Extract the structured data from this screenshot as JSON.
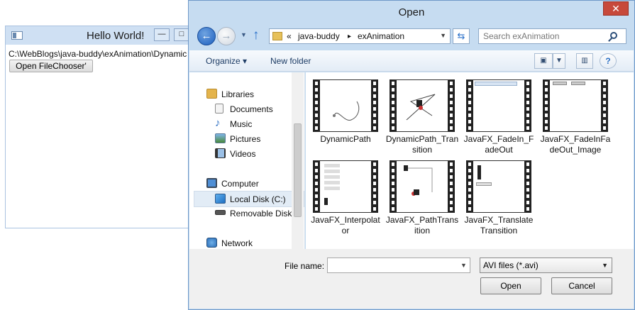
{
  "background_window": {
    "title": "Hello World!",
    "path_text": "C:\\WebBlogs\\java-buddy\\exAnimation\\Dynamic",
    "button_label": "Open FileChooser'",
    "minimize_symbol": "—",
    "maximize_symbol": "□"
  },
  "dialog": {
    "title": "Open",
    "close_symbol": "✕",
    "address": {
      "prefix": "«",
      "crumbs": [
        "java-buddy",
        "exAnimation"
      ],
      "separator": "▸"
    },
    "search": {
      "placeholder": "Search exAnimation"
    },
    "toolbar": {
      "organize": "Organize",
      "organize_arrow": "▾",
      "new_folder": "New folder",
      "help_symbol": "?"
    },
    "nav": {
      "libraries": "Libraries",
      "documents": "Documents",
      "music": "Music",
      "pictures": "Pictures",
      "videos": "Videos",
      "computer": "Computer",
      "local_disk": "Local Disk (C:)",
      "removable_disk": "Removable Disk (",
      "network": "Network"
    },
    "files": [
      {
        "name": "DynamicPath"
      },
      {
        "name": "DynamicPath_Transition"
      },
      {
        "name": "JavaFX_FadeIn_FadeOut"
      },
      {
        "name": "JavaFX_FadeInFadeOut_Image"
      },
      {
        "name": "JavaFX_Interpolator"
      },
      {
        "name": "JavaFX_PathTransition"
      },
      {
        "name": "JavaFX_TranslateTransition"
      }
    ],
    "bottom": {
      "file_name_label": "File name:",
      "file_name_value": "",
      "file_type": "AVI files (*.avi)",
      "open_label": "Open",
      "cancel_label": "Cancel"
    }
  },
  "colors": {
    "dialog_frame": "#c6dcf1",
    "close_button": "#c7493b",
    "selection": "#e2ecf6"
  }
}
